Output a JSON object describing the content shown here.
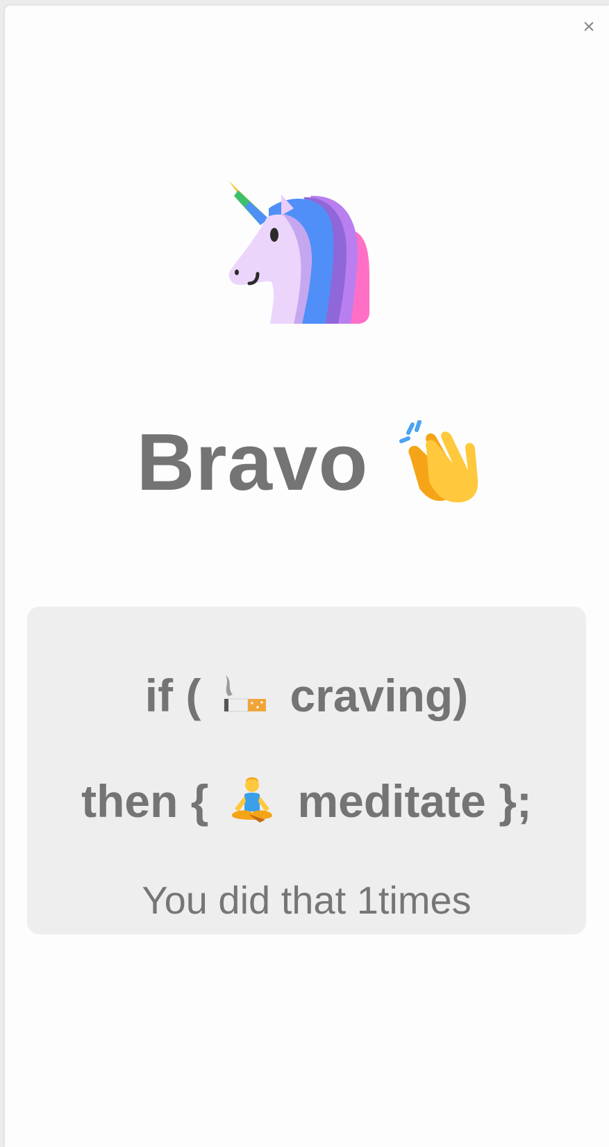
{
  "modal": {
    "close_label": "×"
  },
  "hero": {
    "icon": "unicorn-icon",
    "title": "Bravo",
    "title_icon": "clapping-hands-icon"
  },
  "rule": {
    "if_open": "if (",
    "trigger_icon": "cigarette-icon",
    "trigger_text": "craving)",
    "then_open": "then {",
    "action_icon": "meditating-person-icon",
    "action_text": "meditate };",
    "count_text": "You did that 1times"
  },
  "colors": {
    "text": "#747474",
    "card_bg": "#eeeeee",
    "modal_bg": "#fdfdfd"
  }
}
